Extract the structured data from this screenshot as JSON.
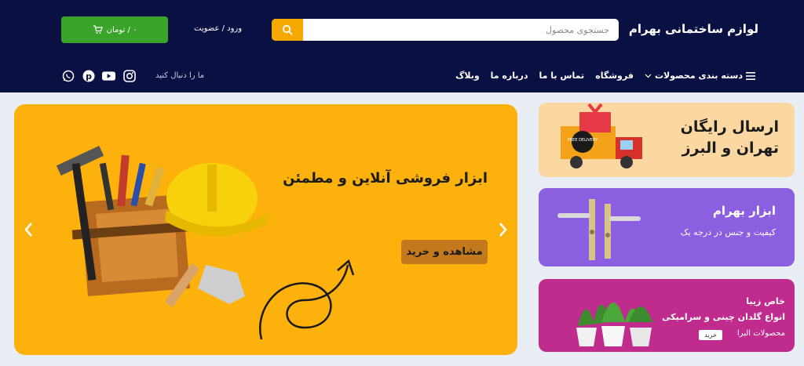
{
  "header": {
    "logo": "لوازم ساختمانی بهرام",
    "search_placeholder": "جستجوی محصول",
    "login": "ورود / عضویت",
    "cart": "۰ / تومان",
    "nav": [
      {
        "label": "دسته بندی محصولات"
      },
      {
        "label": "فروشگاه"
      },
      {
        "label": "تماس با ما"
      },
      {
        "label": "درباره ما"
      },
      {
        "label": "وبلاگ"
      }
    ],
    "follow": "ما را دنبال کنید",
    "socials": [
      "instagram-icon",
      "youtube-icon",
      "pinterest-icon",
      "whatsapp-icon"
    ]
  },
  "hero": {
    "title": "ابزار فروشی آنلاین و مطمئن",
    "button": "مشاهده و خرید"
  },
  "banners": {
    "b1_line1": "ارسال رایگان",
    "b1_line2": "تهران و البرز",
    "b1_truck_label": "FREE DELIVERY",
    "b2_title": "ابزار بهرام",
    "b2_sub": "کیفیت و جنس در درجه یک",
    "b3_l1": "خاص زیبا",
    "b3_l2": "انواع گلدان چینی و سرامیکی",
    "b3_l3": "محصولات البرا",
    "b3_btn": "خرید"
  },
  "colors": {
    "header_bg": "#0b1042",
    "accent": "#f5a800",
    "cart": "#3aa32a",
    "hero": "#fdb10d"
  }
}
